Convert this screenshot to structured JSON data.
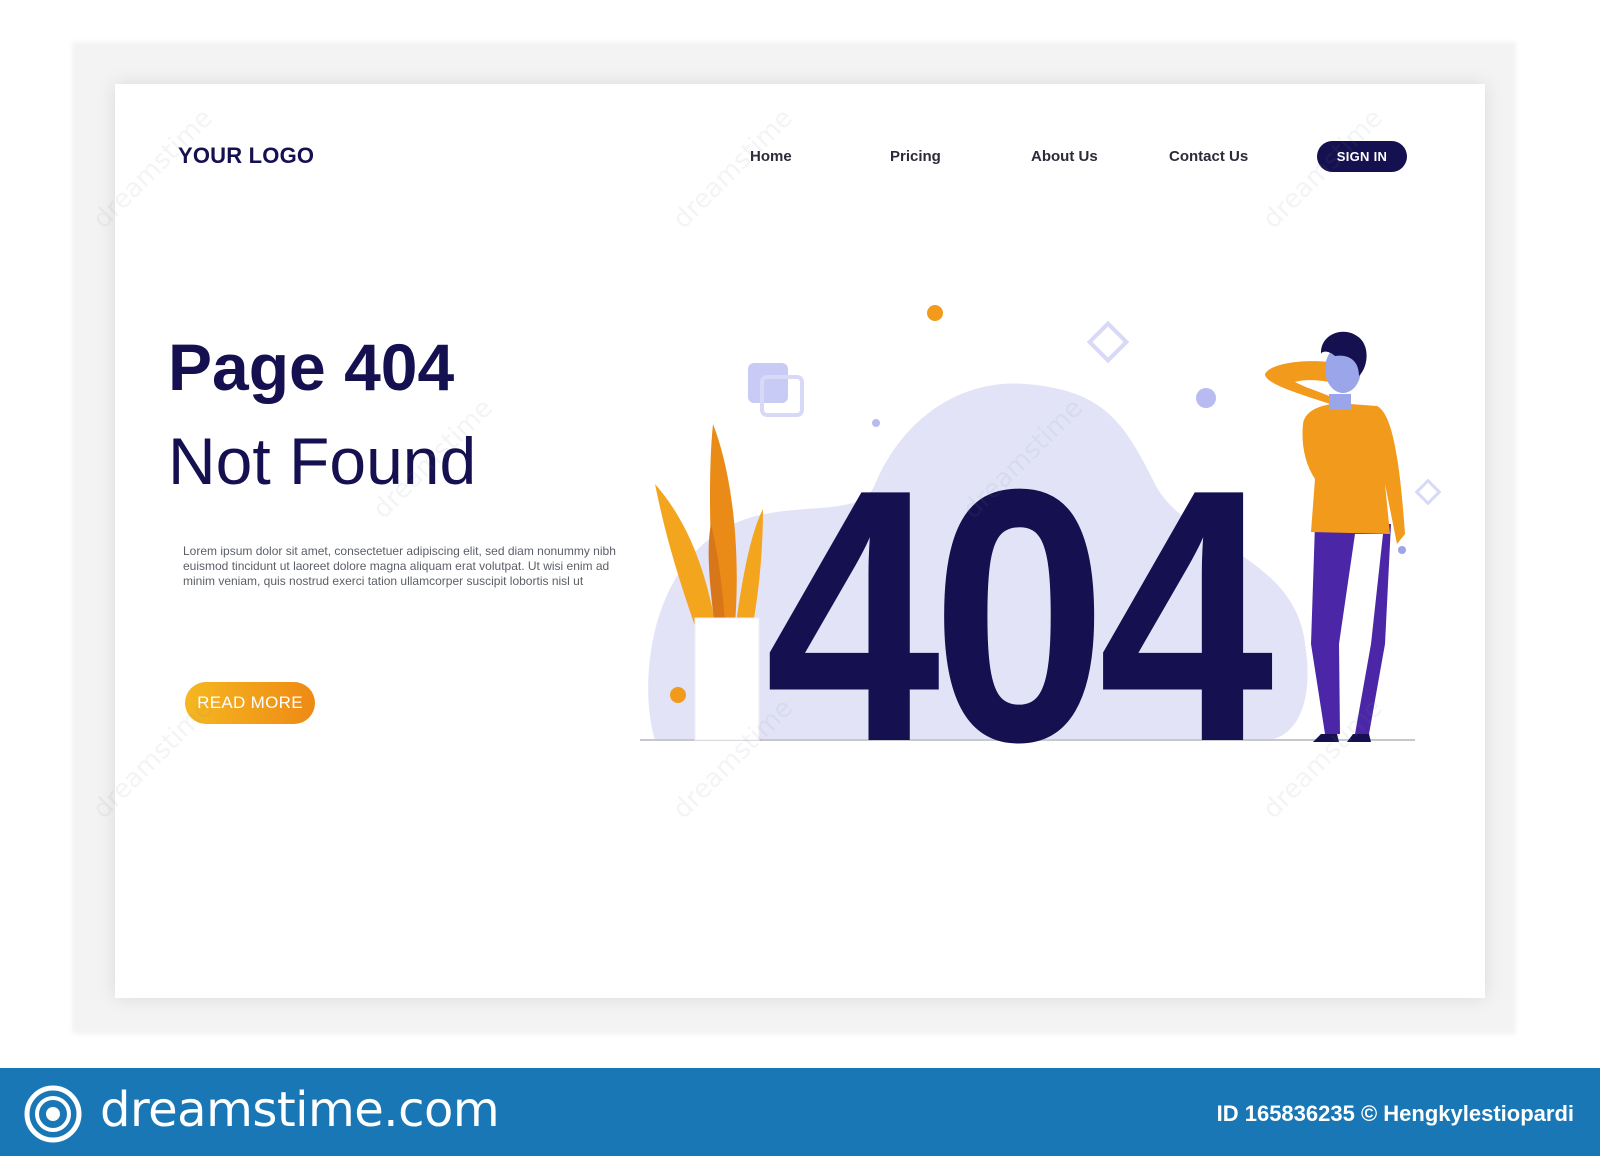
{
  "header": {
    "logo": "YOUR LOGO",
    "nav": [
      "Home",
      "Pricing",
      "About Us",
      "Contact Us"
    ],
    "sign_in_label": "SIGN IN"
  },
  "hero": {
    "title_line1": "Page 404",
    "title_line2": "Not Found",
    "body": "Lorem ipsum dolor sit amet, consectetuer adipiscing elit, sed diam nonummy nibh euismod tincidunt ut laoreet dolore magna aliquam erat volutpat. Ut wisi enim ad minim veniam, quis nostrud exerci tation ullamcorper suscipit lobortis nisl ut",
    "button_label": "READ MORE"
  },
  "illustration": {
    "big_text": "404"
  },
  "footer": {
    "brand": "dreamstime.com",
    "credit": "ID 165836235 © Hengkylestiopardi"
  },
  "watermark": "dreamstime",
  "colors": {
    "navy": "#15104f",
    "orange": "#f29a1b",
    "blob": "#e2e3f7",
    "footer": "#1877b4"
  }
}
